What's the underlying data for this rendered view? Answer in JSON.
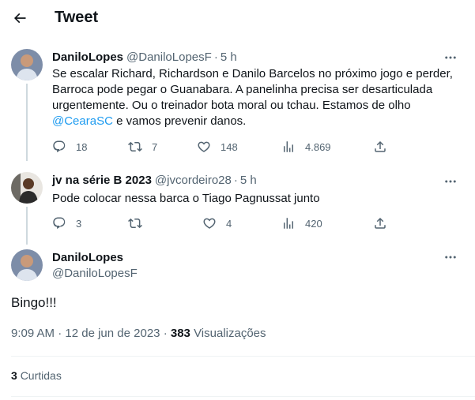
{
  "header": {
    "title": "Tweet"
  },
  "tweets": [
    {
      "name": "DaniloLopes",
      "handle": "@DaniloLopesF",
      "time": "5 h",
      "text_before": "Se escalar Richard, Richardson e Danilo Barcelos no próximo jogo e perder, Barroca pode pegar o Guanabara. A panelinha precisa ser desarticulada urgentemente. Ou o treinador bota moral ou tchau. Estamos de olho ",
      "mention": "@CearaSC",
      "text_after": " e vamos prevenir danos.",
      "replies": "18",
      "retweets": "7",
      "likes": "148",
      "views": "4.869"
    },
    {
      "name": "jv na série B 2023",
      "handle": "@jvcordeiro28",
      "time": "5 h",
      "text": "Pode colocar nessa barca o Tiago Pagnussat junto",
      "replies": "3",
      "retweets": "",
      "likes": "4",
      "views": "420"
    }
  ],
  "main_tweet": {
    "name": "DaniloLopes",
    "handle": "@DaniloLopesF",
    "text": "Bingo!!!",
    "time": "9:09 AM",
    "date": "12 de jun de 2023",
    "views_count": "383",
    "views_label": "Visualizações",
    "likes_count": "3",
    "likes_label": "Curtidas"
  },
  "colors": {
    "accent": "#1d9bf0",
    "text": "#0f1419",
    "secondary": "#536471",
    "border": "#eff3f4"
  },
  "icons": [
    "back-arrow-icon",
    "more-icon",
    "reply-icon",
    "retweet-icon",
    "like-icon",
    "views-icon",
    "share-icon"
  ]
}
